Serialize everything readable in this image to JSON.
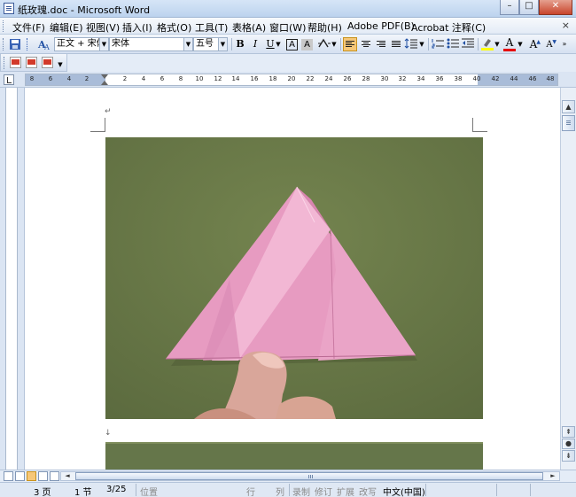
{
  "window": {
    "title": "纸玫瑰.doc - Microsoft Word",
    "minimize": "–",
    "maximize": "□",
    "close": "✕"
  },
  "menu": {
    "items": [
      "文件(F)",
      "编辑(E)",
      "视图(V)",
      "插入(I)",
      "格式(O)",
      "工具(T)",
      "表格(A)",
      "窗口(W)",
      "帮助(H)",
      "Adobe PDF(B)",
      "Acrobat 注释(C)"
    ],
    "close_doc": "×"
  },
  "format_toolbar": {
    "style_value": "正文 + 宋体",
    "font_value": "宋体",
    "size_value": "五号",
    "bold": "B",
    "italic": "I",
    "underline": "U",
    "char_border": "A",
    "char_shading": "A",
    "scale": "✕",
    "font_color": "A",
    "grow_font": "A",
    "shrink_font": "A"
  },
  "ruler": {
    "ticks": [
      "8",
      "6",
      "4",
      "2",
      "2",
      "4",
      "6",
      "8",
      "10",
      "12",
      "14",
      "16",
      "18",
      "20",
      "22",
      "24",
      "26",
      "28",
      "30",
      "32",
      "34",
      "36",
      "38",
      "40",
      "42",
      "44",
      "46",
      "48"
    ]
  },
  "document": {
    "paragraph_mark": "↵",
    "paragraph_mark_2": "↓"
  },
  "status": {
    "page": "3 页",
    "section": "1 节",
    "page_of": "3/25",
    "position": "位置",
    "line": "行",
    "column": "列",
    "record": "录制",
    "revise": "修订",
    "extend": "扩展",
    "overtype": "改写",
    "language": "中文(中国)"
  },
  "colors": {
    "background_green": "#67774a",
    "origami_pink": "#e89cc0",
    "highlight_yellow": "#f6c778",
    "title_bar": "#bcd3ee"
  }
}
